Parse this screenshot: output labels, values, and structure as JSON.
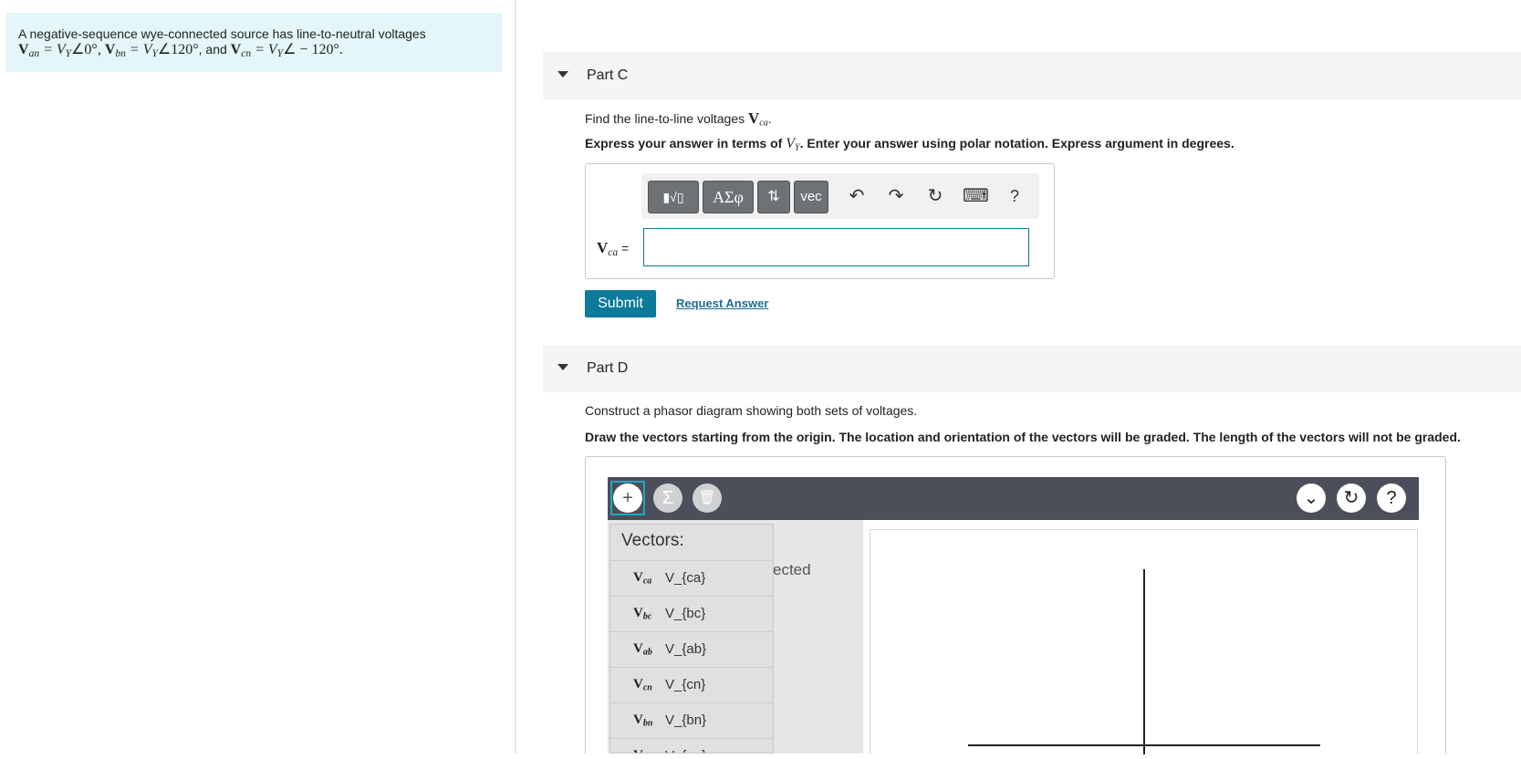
{
  "problem": {
    "line1": "A negative-sequence wye-connected source has line-to-neutral voltages",
    "van_v": "V",
    "van_sub": "an",
    "van_rhs": " = V",
    "van_rhs_sub": "Y",
    "van_angle": "∠0°",
    "sep1": ", ",
    "vbn_v": "V",
    "vbn_sub": "bn",
    "vbn_rhs": " = V",
    "vbn_rhs_sub": "Y",
    "vbn_angle": "∠120°",
    "sep2": ", and ",
    "vcn_v": "V",
    "vcn_sub": "cn",
    "vcn_rhs": " = V",
    "vcn_rhs_sub": "Y",
    "vcn_angle": "∠ − 120°",
    "end": "."
  },
  "partC": {
    "title": "Part C",
    "find_prefix": "Find the line-to-line voltages ",
    "find_v": "V",
    "find_sub": "ca",
    "find_end": ".",
    "express_prefix": "Express your answer in terms of ",
    "express_var": "V",
    "express_var_sub": "Y",
    "express_suffix": ". Enter your answer using polar notation. Express argument in degrees.",
    "toolbar": {
      "templates_label": "▮√▯",
      "greek_label": "ΑΣφ",
      "arrows_label": "⇅",
      "vec_label": "vec",
      "undo_glyph": "↶",
      "redo_glyph": "↷",
      "reset_glyph": "↻",
      "keyboard_glyph": "⌨",
      "help_glyph": "?"
    },
    "lhs_v": "V",
    "lhs_sub": "ca",
    "lhs_eq": " =",
    "answer_value": "",
    "submit_label": "Submit",
    "request_label": "Request Answer"
  },
  "partD": {
    "title": "Part D",
    "instruction": "Construct a phasor diagram showing both sets of voltages.",
    "bold_instruction": "Draw the vectors starting from the origin. The location and orientation of the vectors will be graded. The length of the vectors will not be graded.",
    "tool": {
      "add_glyph": "+",
      "sum_glyph": "Σ",
      "trash_glyph": "🗑",
      "dropdown_glyph": "⌄",
      "reset_glyph": "↻",
      "help_glyph": "?",
      "ghost_text": "ected",
      "menu_header": "Vectors:",
      "vectors": [
        {
          "v": "V",
          "sub": "ca",
          "code": "V_{ca}"
        },
        {
          "v": "V",
          "sub": "bc",
          "code": "V_{bc}"
        },
        {
          "v": "V",
          "sub": "ab",
          "code": "V_{ab}"
        },
        {
          "v": "V",
          "sub": "cn",
          "code": "V_{cn}"
        },
        {
          "v": "V",
          "sub": "bn",
          "code": "V_{bn}"
        },
        {
          "v": "V",
          "sub": "an",
          "code": "V_{an}"
        }
      ]
    }
  },
  "colors": {
    "problem_bg": "#e4f6f8",
    "submit_bg": "#0c7a9a",
    "link": "#1c6c96",
    "toolbar_dark": "#4b4f59"
  }
}
